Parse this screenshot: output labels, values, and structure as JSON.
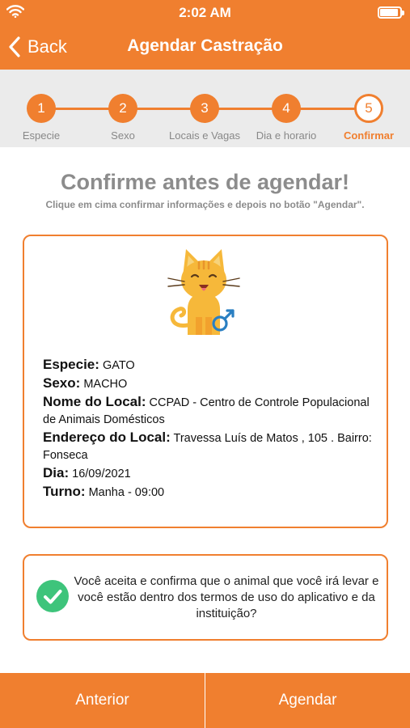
{
  "status_bar": {
    "time": "2:02 AM",
    "battery_level": 0.85
  },
  "nav": {
    "back_label": "Back",
    "title": "Agendar Castração"
  },
  "stepper": {
    "steps": [
      {
        "number": "1",
        "label": "Especie"
      },
      {
        "number": "2",
        "label": "Sexo"
      },
      {
        "number": "3",
        "label": "Locais e Vagas"
      },
      {
        "number": "4",
        "label": "Dia e horario"
      },
      {
        "number": "5",
        "label": "Confirmar"
      }
    ],
    "active_step": 5
  },
  "header": {
    "title": "Confirme antes de agendar!",
    "subtitle": "Clique em cima confirmar informações e depois no botão \"Agendar\"."
  },
  "summary": {
    "especie_label": "Especie:",
    "especie_value": " GATO",
    "sexo_label": "Sexo:",
    "sexo_value": " MACHO",
    "local_label": "Nome do Local:",
    "local_value": " CCPAD - Centro de Controle Populacional de Animais Domésticos",
    "endereco_label": "Endereço do Local:",
    "endereco_value": " Travessa Luís de Matos , 105 . Bairro: Fonseca",
    "dia_label": "Dia:",
    "dia_value": " 16/09/2021",
    "turno_label": "Turno:",
    "turno_value": " Manha - 09:00",
    "illustration_icon": "cat-male-icon"
  },
  "confirmation": {
    "text": "Você aceita e confirma que o animal que você irá levar e você estão dentro dos termos de uso do aplicativo e da instituição?",
    "checked": true,
    "check_color": "#3ec47b"
  },
  "footer": {
    "previous_label": "Anterior",
    "schedule_label": "Agendar"
  },
  "theme": {
    "accent": "#f07f2f",
    "muted_text": "#8c8c8c",
    "stepper_bg": "#ebebeb"
  }
}
